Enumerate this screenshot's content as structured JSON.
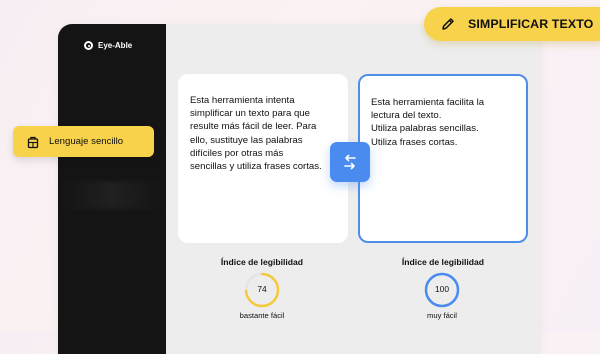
{
  "brand": {
    "name": "Eye-Able"
  },
  "toolbar": {
    "simplify_label": "SIMPLIFICAR TEXTO"
  },
  "sidebar_button": {
    "label": "Lenguaje sencillo"
  },
  "original": {
    "text": "Esta herramienta intenta\nsimplificar un texto para que\nresulte más fácil de leer. Para\nello, sustituye las palabras\ndifíciles por otras más\nsencillas y utiliza frases cortas."
  },
  "simplified": {
    "text": "Esta herramienta facilita la\nlectura del texto.\nUtiliza palabras sencillas.\nUtiliza frases cortas."
  },
  "readability": {
    "original": {
      "title": "Índice de legibilidad",
      "value": "74",
      "fraction": 0.74,
      "label": "bastante fácil",
      "color": "#f7c93c"
    },
    "simplified": {
      "title": "Índice de legibilidad",
      "value": "100",
      "fraction": 1.0,
      "label": "muy fácil",
      "color": "#4a8bf0"
    }
  },
  "icons": {
    "swap": "swap-arrows-icon",
    "pencil": "pencil-icon",
    "plain_language": "puzzle-book-icon",
    "brand": "eye-logo-icon"
  }
}
